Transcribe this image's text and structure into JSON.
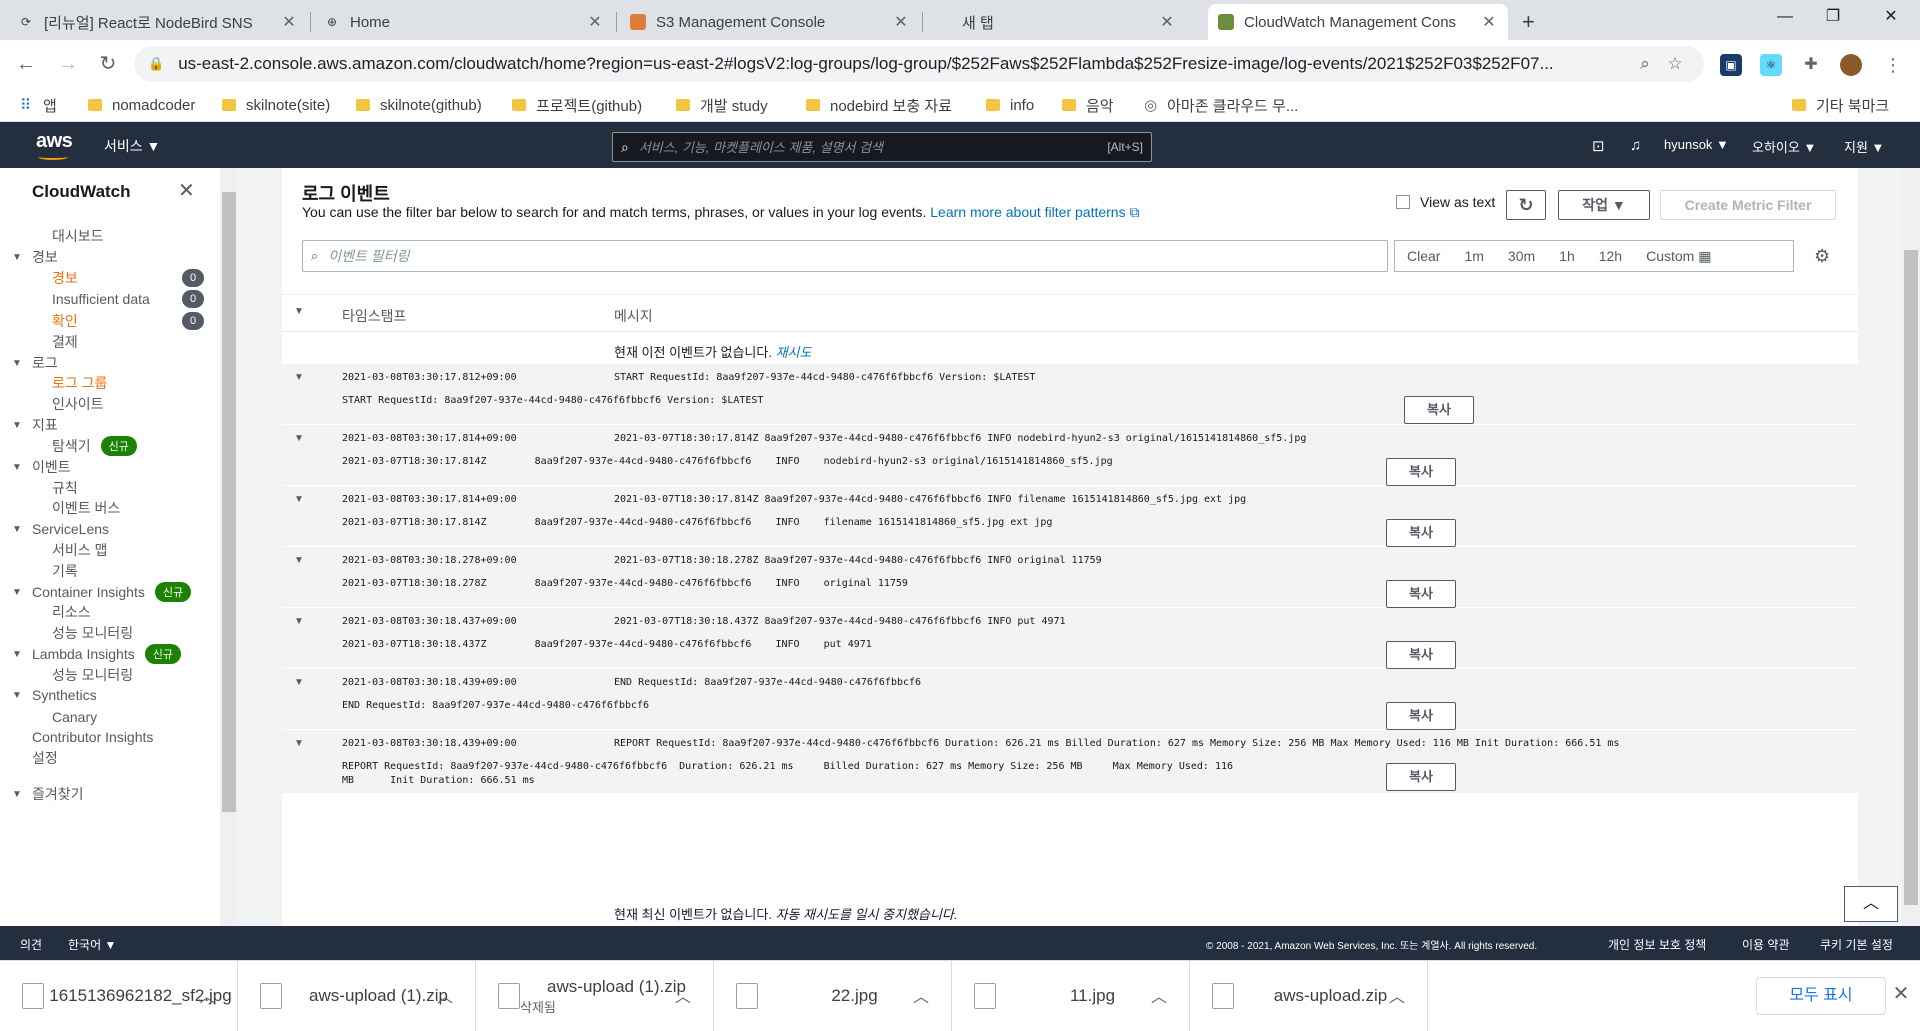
{
  "browser": {
    "tabs": [
      {
        "title": "[리뉴얼] React로 NodeBird SNS",
        "icon": "search-icon"
      },
      {
        "title": "Home",
        "icon": "globe-icon"
      },
      {
        "title": "S3 Management Console",
        "icon": "s3-icon"
      },
      {
        "title": "새 탭",
        "icon": ""
      },
      {
        "title": "CloudWatch Management Cons",
        "icon": "cloudwatch-icon"
      }
    ],
    "url": "us-east-2.console.aws.amazon.com/cloudwatch/home?region=us-east-2#logsV2:log-groups/log-group/$252Faws$252Flambda$252Fresize-image/log-events/2021$252F03$252F07...",
    "bookmarks": [
      "앱",
      "nomadcoder",
      "skilnote(site)",
      "skilnote(github)",
      "프로젝트(github)",
      "개발 study",
      "nodebird 보충 자료",
      "info",
      "음악",
      "아마존 클라우드 무...",
      "기타 북마크"
    ]
  },
  "aws": {
    "logo": "aws",
    "services": "서비스 ▼",
    "search_placeholder": "서비스, 기능, 마켓플레이스 제품, 설명서 검색",
    "search_shortcut": "[Alt+S]",
    "user": "hyunsok ▼",
    "region": "오하이오 ▼",
    "support": "지원 ▼"
  },
  "sidebar": {
    "title": "CloudWatch",
    "items": [
      {
        "label": "대시보드",
        "level": 1,
        "caret": false
      },
      {
        "label": "경보",
        "level": 0,
        "caret": true
      },
      {
        "label": "경보",
        "level": 1,
        "active": true,
        "count": "0"
      },
      {
        "label": "Insufficient data",
        "level": 1,
        "count": "0"
      },
      {
        "label": "확인",
        "level": 1,
        "active": true,
        "count": "0"
      },
      {
        "label": "결제",
        "level": 1
      },
      {
        "label": "로그",
        "level": 0,
        "caret": true
      },
      {
        "label": "로그 그룹",
        "level": 1,
        "active": true
      },
      {
        "label": "인사이트",
        "level": 1
      },
      {
        "label": "지표",
        "level": 0,
        "caret": true
      },
      {
        "label": "탐색기",
        "level": 1,
        "badge": "신규"
      },
      {
        "label": "이벤트",
        "level": 0,
        "caret": true
      },
      {
        "label": "규칙",
        "level": 1
      },
      {
        "label": "이벤트 버스",
        "level": 1
      },
      {
        "label": "ServiceLens",
        "level": 0,
        "caret": true
      },
      {
        "label": "서비스 맵",
        "level": 1
      },
      {
        "label": "기록",
        "level": 1
      },
      {
        "label": "Container Insights",
        "level": 0,
        "caret": true,
        "badge": "신규"
      },
      {
        "label": "리소스",
        "level": 1
      },
      {
        "label": "성능 모니터링",
        "level": 1
      },
      {
        "label": "Lambda Insights",
        "level": 0,
        "caret": true,
        "badge": "신규"
      },
      {
        "label": "성능 모니터링",
        "level": 1
      },
      {
        "label": "Synthetics",
        "level": 0,
        "caret": true
      },
      {
        "label": "Canary",
        "level": 1
      },
      {
        "label": "Contributor Insights",
        "level": 0
      },
      {
        "label": "설정",
        "level": 0
      },
      {
        "label": "즐겨찾기",
        "level": 0,
        "caret": true
      }
    ]
  },
  "panel": {
    "title": "로그 이벤트",
    "desc": "You can use the filter bar below to search for and match terms, phrases, or values in your log events.",
    "desc_link": "Learn more about filter patterns",
    "view_as_text": "View as text",
    "actions": "작업 ▼",
    "create_metric_filter": "Create Metric Filter",
    "filter_placeholder": "이벤트 필터링",
    "time_buttons": [
      "Clear",
      "1m",
      "30m",
      "1h",
      "12h",
      "Custom"
    ],
    "col_timestamp": "타임스탬프",
    "col_message": "메시지",
    "notice_top": "현재 이전 이벤트가 없습니다.",
    "notice_top_link": "재시도",
    "notice_bottom": "현재 최신 이벤트가 없습니다.",
    "notice_bottom_italic": "자동 재시도를 일시 중지했습니다.",
    "copy_label": "복사",
    "events": [
      {
        "ts": "2021-03-08T03:30:17.812+09:00",
        "msg": "START RequestId: 8aa9f207-937e-44cd-9480-c476f6fbbcf6 Version: $LATEST",
        "detail": "START RequestId: 8aa9f207-937e-44cd-9480-c476f6fbbcf6 Version: $LATEST"
      },
      {
        "ts": "2021-03-08T03:30:17.814+09:00",
        "msg": "2021-03-07T18:30:17.814Z 8aa9f207-937e-44cd-9480-c476f6fbbcf6 INFO nodebird-hyun2-s3 original/1615141814860_sf5.jpg",
        "detail": "2021-03-07T18:30:17.814Z        8aa9f207-937e-44cd-9480-c476f6fbbcf6    INFO    nodebird-hyun2-s3 original/1615141814860_sf5.jpg"
      },
      {
        "ts": "2021-03-08T03:30:17.814+09:00",
        "msg": "2021-03-07T18:30:17.814Z 8aa9f207-937e-44cd-9480-c476f6fbbcf6 INFO filename 1615141814860_sf5.jpg ext jpg",
        "detail": "2021-03-07T18:30:17.814Z        8aa9f207-937e-44cd-9480-c476f6fbbcf6    INFO    filename 1615141814860_sf5.jpg ext jpg"
      },
      {
        "ts": "2021-03-08T03:30:18.278+09:00",
        "msg": "2021-03-07T18:30:18.278Z 8aa9f207-937e-44cd-9480-c476f6fbbcf6 INFO original 11759",
        "detail": "2021-03-07T18:30:18.278Z        8aa9f207-937e-44cd-9480-c476f6fbbcf6    INFO    original 11759"
      },
      {
        "ts": "2021-03-08T03:30:18.437+09:00",
        "msg": "2021-03-07T18:30:18.437Z 8aa9f207-937e-44cd-9480-c476f6fbbcf6 INFO put 4971",
        "detail": "2021-03-07T18:30:18.437Z        8aa9f207-937e-44cd-9480-c476f6fbbcf6    INFO    put 4971"
      },
      {
        "ts": "2021-03-08T03:30:18.439+09:00",
        "msg": "END RequestId: 8aa9f207-937e-44cd-9480-c476f6fbbcf6",
        "detail": "END RequestId: 8aa9f207-937e-44cd-9480-c476f6fbbcf6"
      },
      {
        "ts": "2021-03-08T03:30:18.439+09:00",
        "msg": "REPORT RequestId: 8aa9f207-937e-44cd-9480-c476f6fbbcf6 Duration: 626.21 ms Billed Duration: 627 ms Memory Size: 256 MB Max Memory Used: 116 MB Init Duration: 666.51 ms",
        "detail": "REPORT RequestId: 8aa9f207-937e-44cd-9480-c476f6fbbcf6  Duration: 626.21 ms     Billed Duration: 627 ms Memory Size: 256 MB     Max Memory Used: 116\nMB      Init Duration: 666.51 ms"
      }
    ]
  },
  "footer": {
    "feedback": "의견",
    "language": "한국어 ▼",
    "copyright": "© 2008 - 2021, Amazon Web Services, Inc. 또는 계열사. All rights reserved.",
    "privacy": "개인 정보 보호 정책",
    "terms": "이용 약관",
    "cookies": "쿠키 기본 설정"
  },
  "downloads": {
    "items": [
      {
        "name": "1615136962182_sf2.jpg",
        "sub": "",
        "type": "jpg"
      },
      {
        "name": "aws-upload (1).zip",
        "sub": "",
        "type": "zip"
      },
      {
        "name": "aws-upload (1).zip",
        "sub": "삭제됨",
        "type": "zip"
      },
      {
        "name": "22.jpg",
        "sub": "",
        "type": "jpg"
      },
      {
        "name": "11.jpg",
        "sub": "",
        "type": "jpg"
      },
      {
        "name": "aws-upload.zip",
        "sub": "",
        "type": "zip"
      }
    ],
    "show_all": "모두 표시"
  }
}
